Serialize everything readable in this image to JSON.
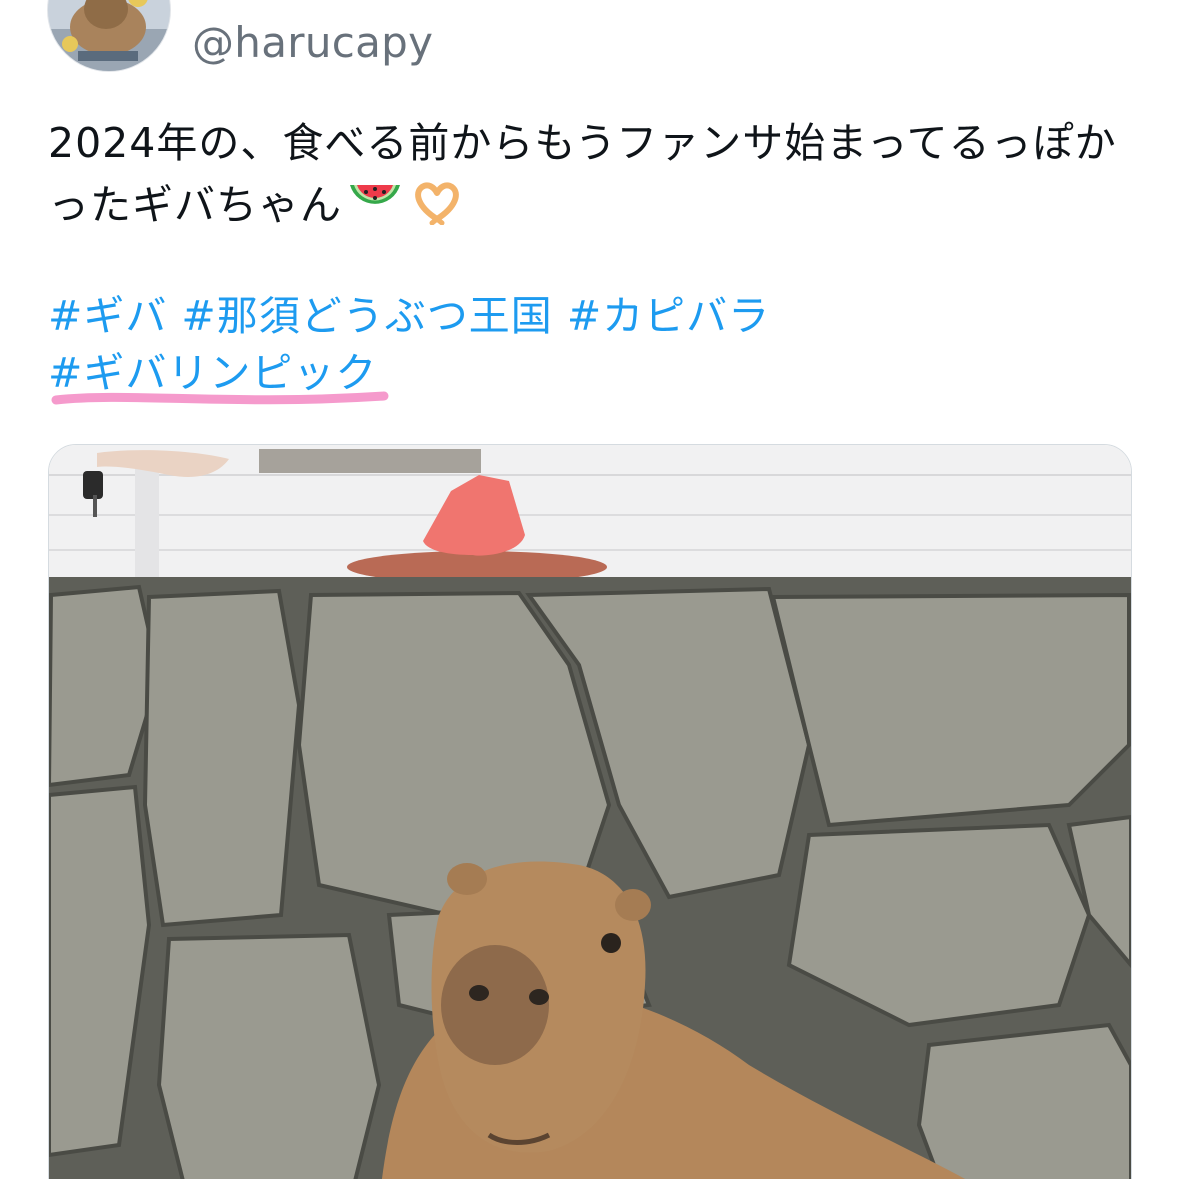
{
  "author": {
    "handle": "@harucapy",
    "avatar_icon": "capybara-avatar"
  },
  "tweet": {
    "text_line1": "2024年の、食べる前からもうファンサ始まってるっぽか",
    "text_line2": "ったギバちゃん",
    "emojis": [
      "watermelon-emoji",
      "heart-hands-emoji"
    ],
    "hashtags": [
      "#ギバ",
      "#那須どうぶつ王国",
      "#カピバラ",
      "#ギバリンピック"
    ]
  },
  "media": {
    "description_icon": "capybara-photo"
  },
  "colors": {
    "text": "#0f1419",
    "handle": "#68717b",
    "hashtag": "#1d9bf0",
    "highlight": "#f48fc6"
  }
}
